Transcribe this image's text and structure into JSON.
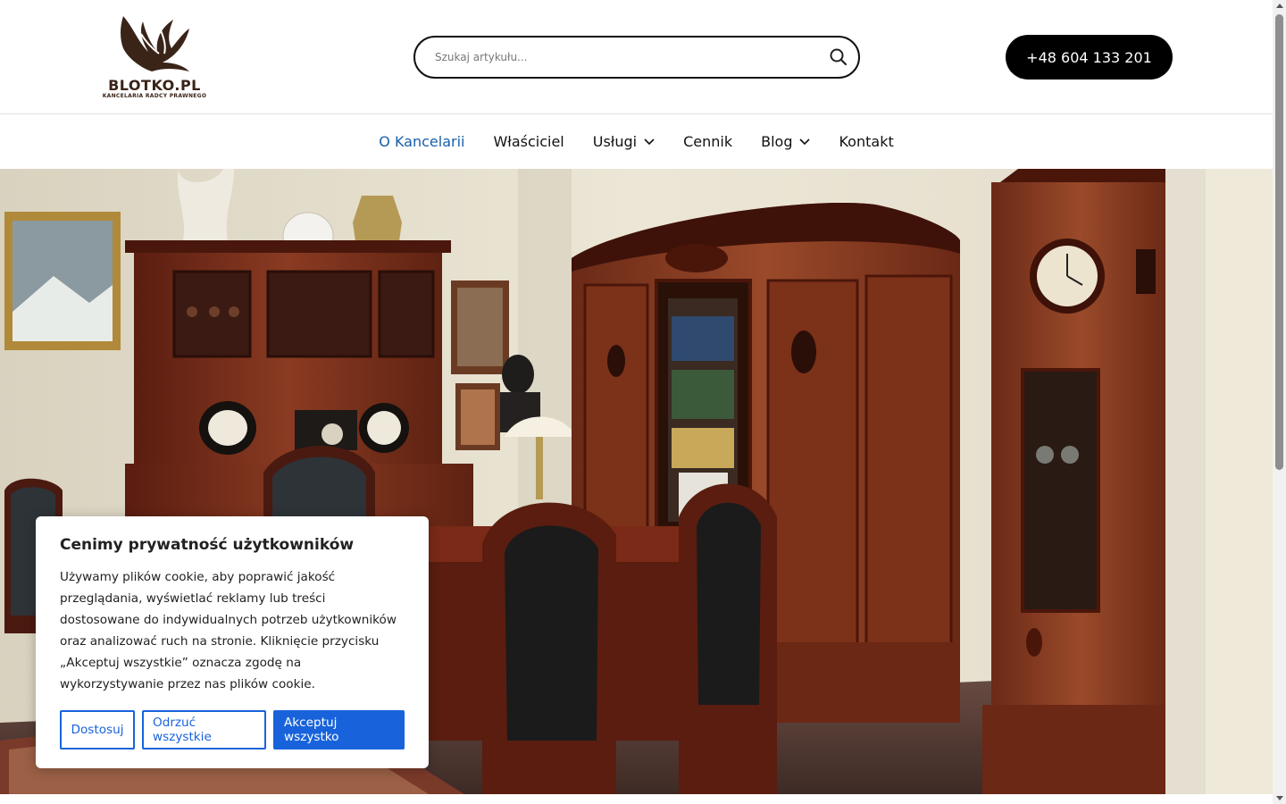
{
  "header": {
    "logo_text": "BLOTKO.PL",
    "logo_subtitle": "KANCELARIA RADCY PRAWNEGO",
    "search_placeholder": "Szukaj artykułu...",
    "phone_label": "+48 604 133 201"
  },
  "nav": {
    "items": [
      {
        "label": "O Kancelarii",
        "active": true,
        "dropdown": false
      },
      {
        "label": "Właściciel",
        "active": false,
        "dropdown": false
      },
      {
        "label": "Usługi",
        "active": false,
        "dropdown": true
      },
      {
        "label": "Cennik",
        "active": false,
        "dropdown": false
      },
      {
        "label": "Blog",
        "active": false,
        "dropdown": true
      },
      {
        "label": "Kontakt",
        "active": false,
        "dropdown": false
      }
    ]
  },
  "cookie": {
    "title": "Cenimy prywatność użytkowników",
    "text": "Używamy plików cookie, aby poprawić jakość przeglądania, wyświetlać reklamy lub treści dostosowane do indywidualnych potrzeb użytkowników oraz analizować ruch na stronie. Kliknięcie przycisku „Akceptuj wszystkie” oznacza zgodę na wykorzystywanie przez nas plików cookie.",
    "customize_label": "Dostosuj",
    "reject_label": "Odrzuć wszystkie",
    "accept_label": "Akceptuj wszystko"
  },
  "colors": {
    "accent": "#1863dc",
    "nav_active": "#1a5fa8",
    "logo_brown": "#3a2418"
  },
  "icons": {
    "search": "search-icon",
    "chevron": "chevron-down-icon"
  }
}
